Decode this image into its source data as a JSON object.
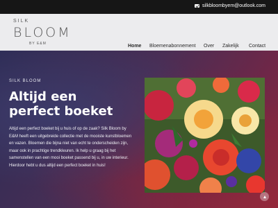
{
  "topbar": {
    "email": "silkbloombyem@outlook.com",
    "email_icon": "envelope-icon"
  },
  "brand": {
    "line1": "SILK",
    "line2": "BLOOM",
    "line3": "BY E&M"
  },
  "nav": {
    "items": [
      "Home",
      "Bloemenabonnement",
      "Over",
      "Zakelijk",
      "Contact"
    ]
  },
  "hero": {
    "eyebrow": "SILK BLOOM",
    "title": "Altijd een perfect boeket",
    "body": "Altijd een perfect boeket bij u huis of op de zaak? Silk Bloom by E&M heeft een uitgebreide collectie met de mooiste kunstbloemen en vazen. Bloemen die bijna niet van echt te onderscheiden zijn, maar ook in prachtige trendkleuren. Ik help u graag bij het samenstellen van een mooi boeket passend bij u, in uw interieur. Hierdoor hebt u dus altijd een perfect boeket in huis!",
    "image_icon": "flower-bouquet-image",
    "scroll_icon": "arrow-up-icon"
  }
}
